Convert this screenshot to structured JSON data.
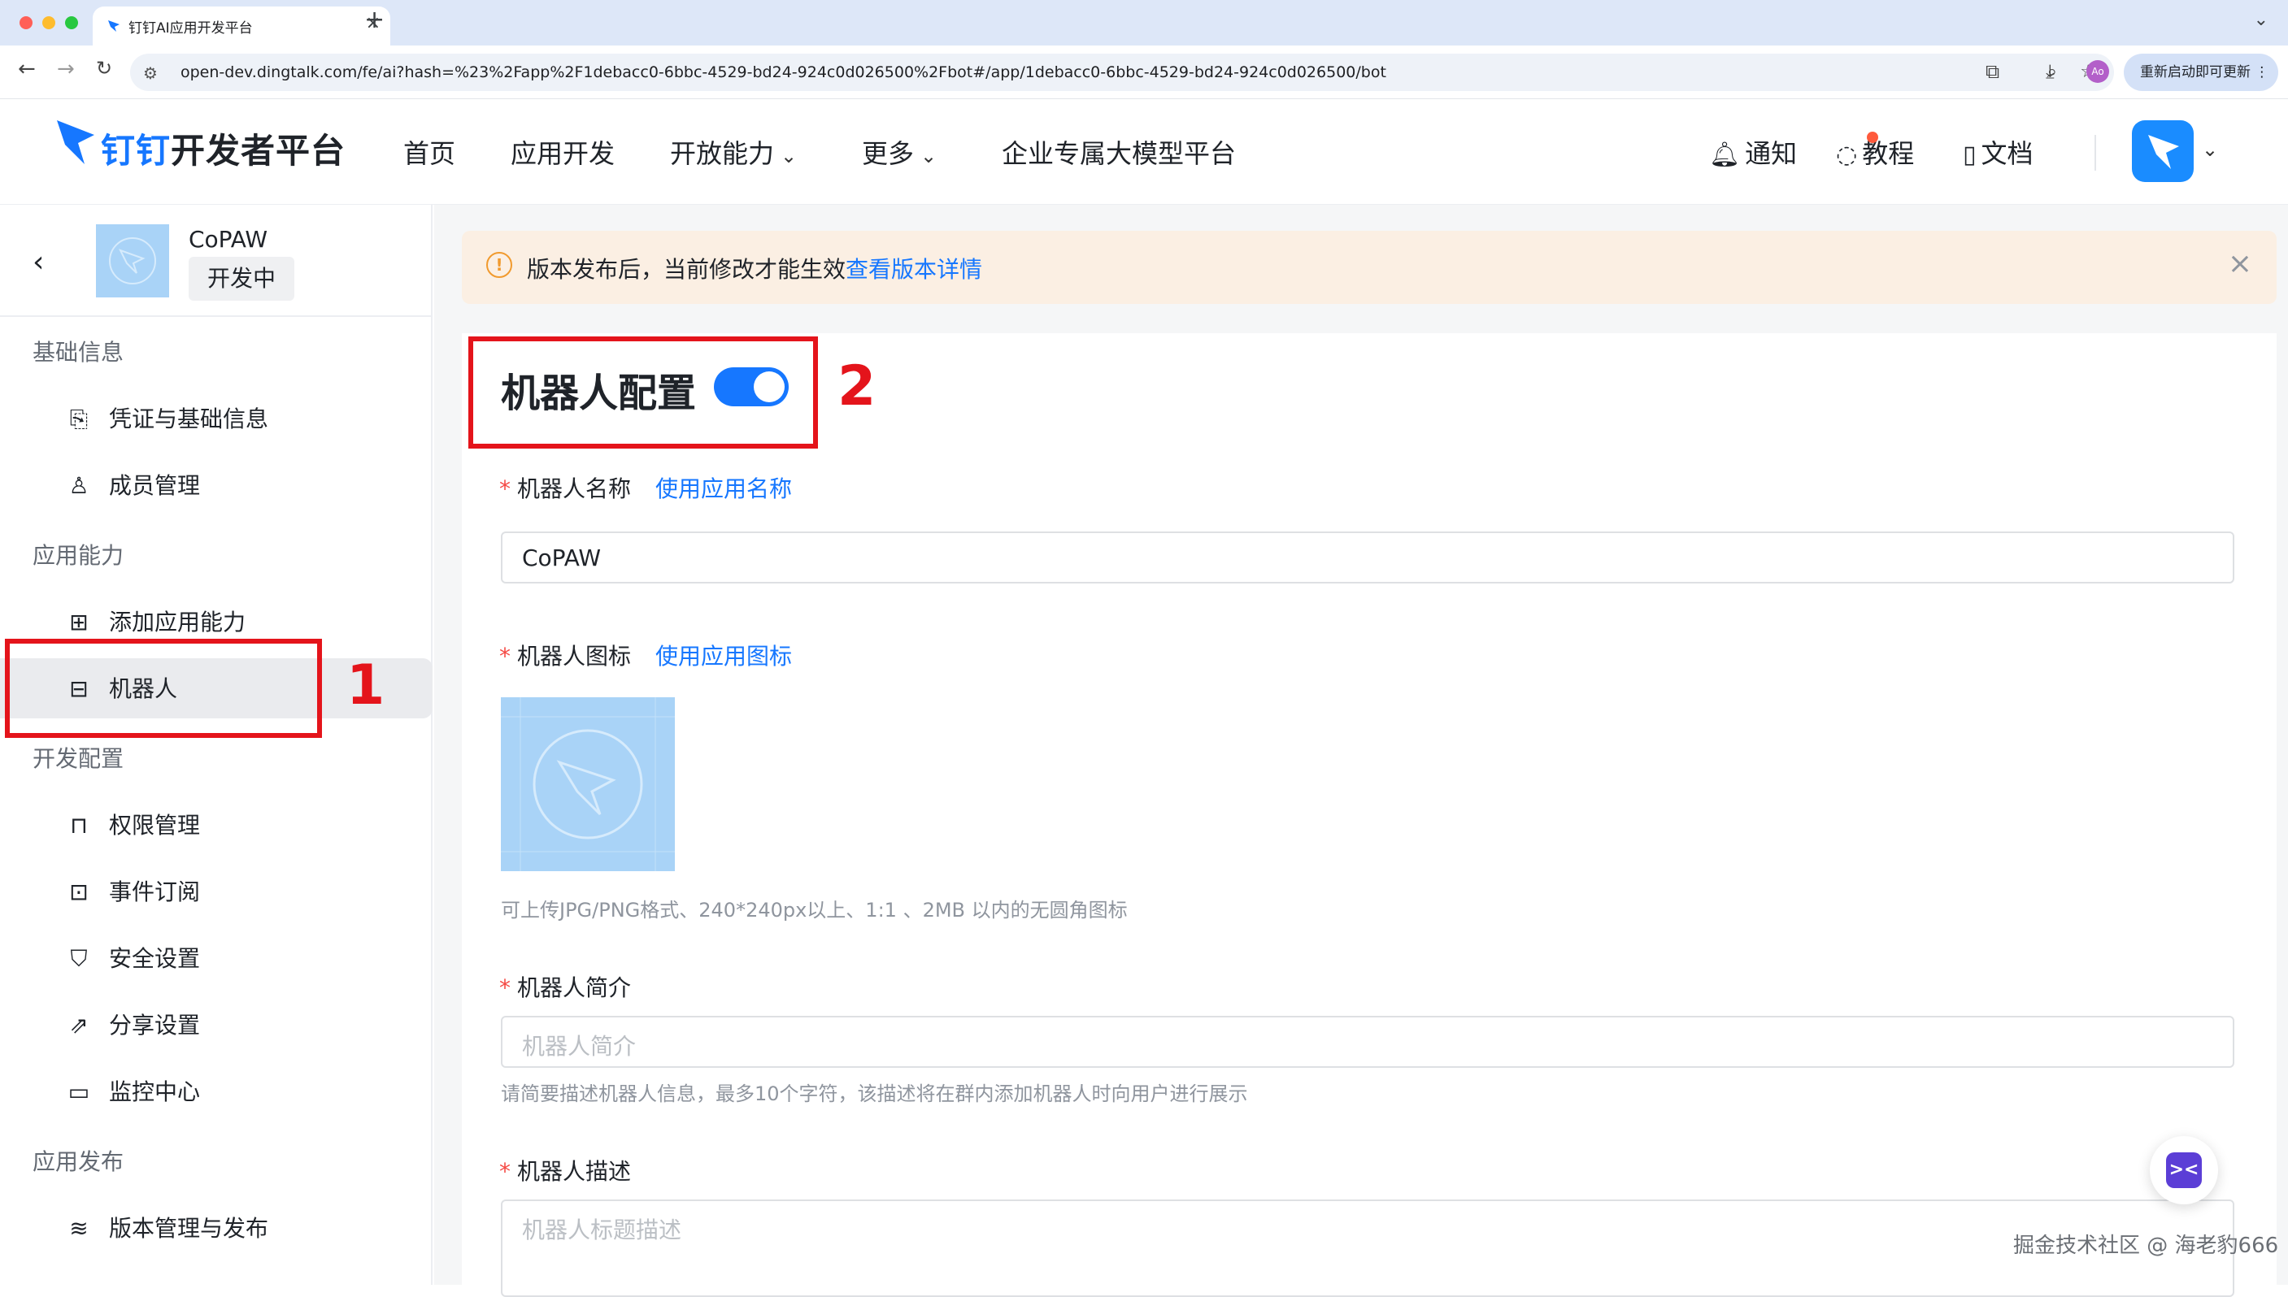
{
  "browser": {
    "tab_title": "钉钉AI应用开发平台",
    "tab_close": "×",
    "new_tab": "+",
    "tab_list": "⌄",
    "url": "open-dev.dingtalk.com/fe/ai?hash=%23%2Fapp%2F1debacc0-6bbc-4529-bd24-924c0d026500%2Fbot#/app/1debacc0-6bbc-4529-bd24-924c0d026500/bot",
    "profile_initials": "Ao",
    "update_button": "重新启动即可更新 ⋮"
  },
  "header": {
    "logo_brand": "钉钉",
    "logo_suffix": "开发者平台",
    "nav": [
      "首页",
      "应用开发",
      "开放能力",
      "更多",
      "企业专属大模型平台"
    ],
    "notify": "通知",
    "tutorial": "教程",
    "docs": "文档"
  },
  "sidebar": {
    "app_name": "CoPAW",
    "app_status": "开发中",
    "groups": [
      "基础信息",
      "应用能力",
      "开发配置",
      "应用发布"
    ],
    "items": [
      {
        "label": "凭证与基础信息",
        "icon": "credential-icon"
      },
      {
        "label": "成员管理",
        "icon": "person-icon"
      },
      {
        "label": "添加应用能力",
        "icon": "grid-add-icon"
      },
      {
        "label": "机器人",
        "icon": "robot-icon"
      },
      {
        "label": "权限管理",
        "icon": "lock-icon"
      },
      {
        "label": "事件订阅",
        "icon": "rss-icon"
      },
      {
        "label": "安全设置",
        "icon": "shield-icon"
      },
      {
        "label": "分享设置",
        "icon": "share-icon"
      },
      {
        "label": "监控中心",
        "icon": "monitor-icon"
      },
      {
        "label": "版本管理与发布",
        "icon": "layers-icon"
      }
    ]
  },
  "alert": {
    "text": "版本发布后，当前修改才能生效",
    "link": "查看版本详情"
  },
  "robot_config": {
    "title": "机器人配置",
    "enabled": true,
    "name_label": "机器人名称",
    "name_link": "使用应用名称",
    "name_value": "CoPAW",
    "icon_label": "机器人图标",
    "icon_link": "使用应用图标",
    "icon_hint": "可上传JPG/PNG格式、240*240px以上、1:1 、2MB 以内的无圆角图标",
    "intro_label": "机器人简介",
    "intro_placeholder": "机器人简介",
    "intro_hint": "请简要描述机器人信息，最多10个字符，该描述将在群内添加机器人时向用户进行展示",
    "desc_label": "机器人描述",
    "desc_placeholder": "机器人标题描述"
  },
  "annotations": {
    "one": "1",
    "two": "2"
  },
  "watermark": "掘金技术社区 @ 海老豹666",
  "colors": {
    "accent": "#1677ff",
    "annotation": "#e4141b",
    "alert_bg": "#fbefe3"
  }
}
